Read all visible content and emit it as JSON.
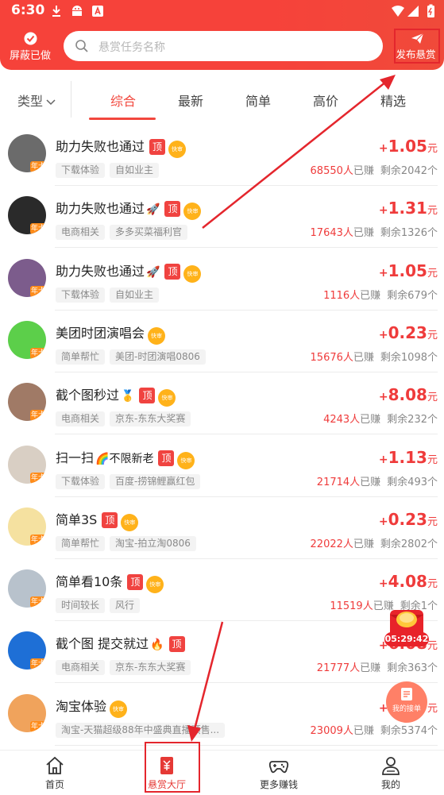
{
  "status_bar": {
    "time": "6:30"
  },
  "header": {
    "block_label": "屏蔽已做",
    "search_placeholder": "悬赏任务名称",
    "publish_label": "发布悬赏"
  },
  "tabs": {
    "type_filter": "类型",
    "items": [
      "综合",
      "最新",
      "简单",
      "高价",
      "精选"
    ],
    "active": "综合"
  },
  "tasks": [
    {
      "title": "助力失败也通过",
      "emoji": "",
      "top": true,
      "quick": true,
      "tags": [
        "下载体验",
        "自如业主"
      ],
      "plus": "+",
      "price": "1.05",
      "unit": "元",
      "count": "68550人",
      "earned": "已赚",
      "remain": "剩余2042个",
      "avatar_color": "#6b6b6b"
    },
    {
      "title": "助力失败也通过",
      "emoji": "🚀",
      "top": true,
      "quick": true,
      "tags": [
        "电商相关",
        "多多买菜福利官"
      ],
      "plus": "+",
      "price": "1.31",
      "unit": "元",
      "count": "17643人",
      "earned": "已赚",
      "remain": "剩余1326个",
      "avatar_color": "#2a2a2a"
    },
    {
      "title": "助力失败也通过",
      "emoji": "🚀",
      "top": true,
      "quick": true,
      "tags": [
        "下载体验",
        "自如业主"
      ],
      "plus": "+",
      "price": "1.05",
      "unit": "元",
      "count": "1116人",
      "earned": "已赚",
      "remain": "剩余679个",
      "avatar_color": "#7c5c8c"
    },
    {
      "title": "美团时团演唱会",
      "emoji": "",
      "top": false,
      "quick": true,
      "tags": [
        "简单帮忙",
        "美团-时团演唱0806"
      ],
      "plus": "+",
      "price": "0.23",
      "unit": "元",
      "count": "15676人",
      "earned": "已赚",
      "remain": "剩余1098个",
      "avatar_color": "#5ccf4a"
    },
    {
      "title": "截个图秒过",
      "emoji": "🥇",
      "top": true,
      "quick": true,
      "tags": [
        "电商相关",
        "京东-东东大奖赛"
      ],
      "plus": "+",
      "price": "8.08",
      "unit": "元",
      "count": "4243人",
      "earned": "已赚",
      "remain": "剩余232个",
      "avatar_color": "#a07a66"
    },
    {
      "title": "扫一扫",
      "emoji": "🌈不限新老",
      "top": true,
      "quick": true,
      "tags": [
        "下载体验",
        "百度-捞锦鲤赢红包"
      ],
      "plus": "+",
      "price": "1.13",
      "unit": "元",
      "count": "21714人",
      "earned": "已赚",
      "remain": "剩余493个",
      "avatar_color": "#d9cfc4"
    },
    {
      "title": "简单3S",
      "emoji": "",
      "top": true,
      "quick": true,
      "tags": [
        "简单帮忙",
        "淘宝-拍立淘0806"
      ],
      "plus": "+",
      "price": "0.23",
      "unit": "元",
      "count": "22022人",
      "earned": "已赚",
      "remain": "剩余2802个",
      "avatar_color": "#f5e1a0"
    },
    {
      "title": "简单看10条",
      "emoji": "",
      "top": true,
      "quick": true,
      "tags": [
        "时间较长",
        "风行"
      ],
      "plus": "+",
      "price": "4.08",
      "unit": "元",
      "count": "11519人",
      "earned": "已赚",
      "remain": "剩余1个",
      "avatar_color": "#b8c2cc"
    },
    {
      "title": "截个图 提交就过",
      "emoji": "🔥",
      "top": true,
      "quick": false,
      "tags": [
        "电商相关",
        "京东-东东大奖赛"
      ],
      "plus": "+",
      "price": "6.08",
      "unit": "元",
      "count": "21777人",
      "earned": "已赚",
      "remain": "剩余363个",
      "avatar_color": "#1e6fd6"
    },
    {
      "title": "淘宝体验",
      "emoji": "",
      "top": false,
      "quick": true,
      "tags": [
        "淘宝-天猫超级88年中盛典直播预售..."
      ],
      "plus": "+",
      "price": "0.23",
      "unit": "元",
      "count": "23009人",
      "earned": "已赚",
      "remain": "剩余5374个",
      "avatar_color": "#f0a35c"
    }
  ],
  "badges": {
    "top": "顶",
    "quick": "快审",
    "vip": "年卡"
  },
  "floating": {
    "timer": "05:29:42",
    "orders_label": "我的接单"
  },
  "bottom_nav": [
    {
      "label": "首页",
      "icon": "home-icon"
    },
    {
      "label": "悬赏大厅",
      "icon": "reward-hall-icon",
      "active": true
    },
    {
      "label": "更多赚钱",
      "icon": "gamepad-icon"
    },
    {
      "label": "我的",
      "icon": "profile-icon"
    }
  ],
  "colors": {
    "brand": "#f6423a",
    "price": "#ef3b3b",
    "annotation": "#e4262d"
  }
}
